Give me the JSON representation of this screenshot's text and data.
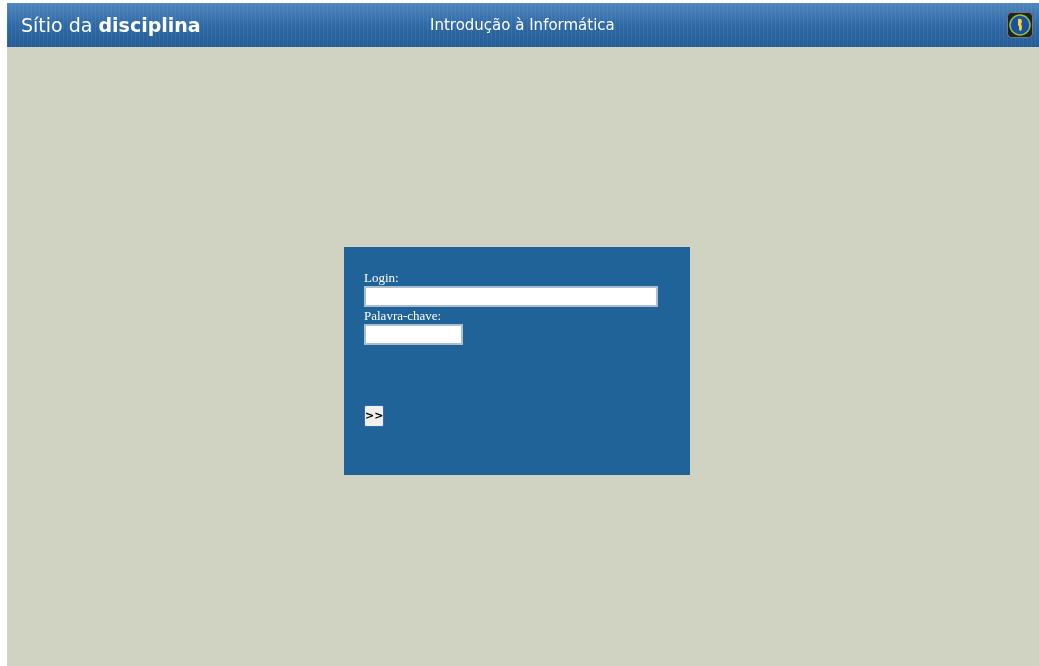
{
  "header": {
    "site_title": "Sítio da **disciplina**",
    "course_title": "Introdução à Informática"
  },
  "login_form": {
    "login_label": "Login:",
    "password_label": "Palavra-chave:",
    "submit_button": ">>"
  }
}
